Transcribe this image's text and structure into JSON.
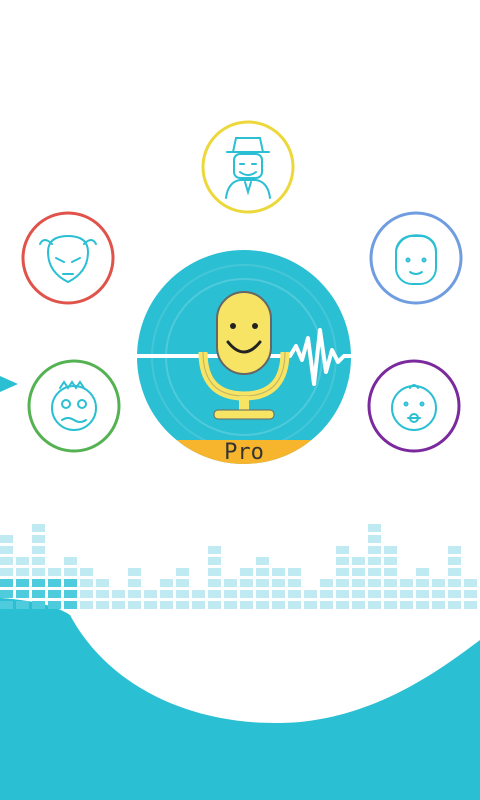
{
  "badge": {
    "label": "Pro"
  },
  "colors": {
    "teal": "#2bbfd3",
    "mic_yellow": "#f7e464",
    "badge_orange": "#f6b52d",
    "ring_yellow": "#ecd83a",
    "ring_red": "#e0534b",
    "ring_blue": "#6f9de0",
    "ring_green": "#55b252",
    "ring_purple": "#7b2a9e"
  },
  "voice_characters": [
    {
      "id": "old-man",
      "icon": "old-man-icon"
    },
    {
      "id": "alien",
      "icon": "alien-icon"
    },
    {
      "id": "boy",
      "icon": "boy-icon"
    },
    {
      "id": "zombie",
      "icon": "zombie-icon"
    },
    {
      "id": "baby",
      "icon": "baby-icon"
    }
  ]
}
